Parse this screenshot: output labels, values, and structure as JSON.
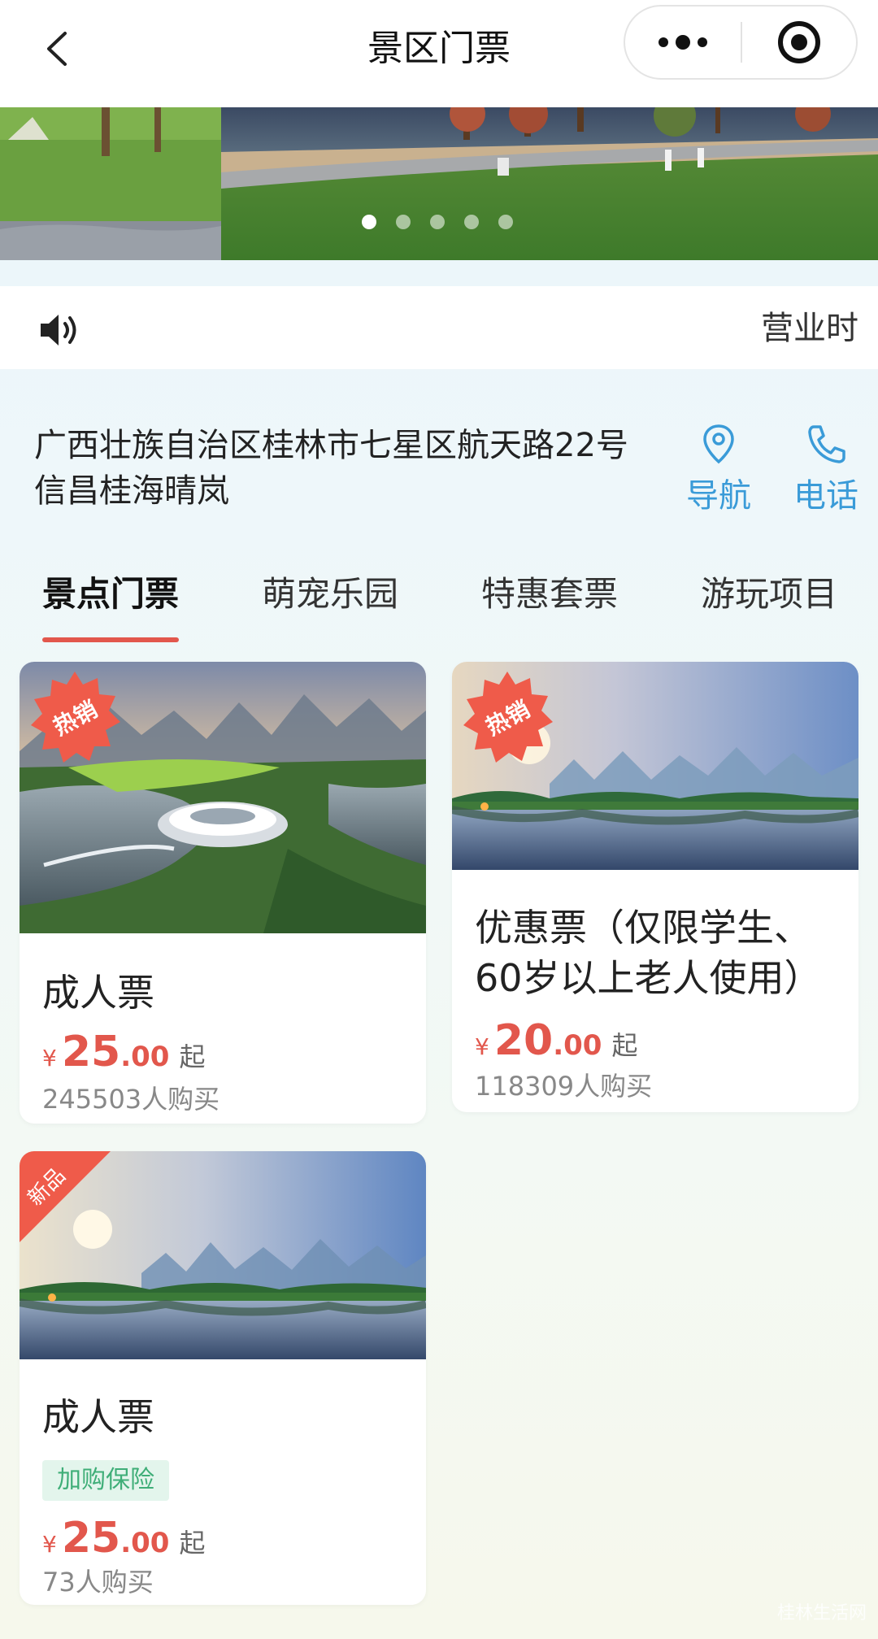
{
  "header": {
    "title": "景区门票"
  },
  "notice": {
    "hours_label": "营业时"
  },
  "address": {
    "text": "广西壮族自治区桂林市七星区航天路22号信昌桂海晴岚"
  },
  "actions": {
    "navigate": "导航",
    "phone": "电话"
  },
  "tabs": [
    {
      "label": "景点门票",
      "active": true
    },
    {
      "label": "萌宠乐园",
      "active": false
    },
    {
      "label": "特惠套票",
      "active": false
    },
    {
      "label": "游玩项目",
      "active": false
    }
  ],
  "carousel": {
    "count": 5,
    "active_index": 0
  },
  "cards": [
    {
      "badge": "热销",
      "title": "成人票",
      "yen": "¥",
      "price_int": "25",
      "price_dec": ".00",
      "from": "起",
      "sold": "245503人购买"
    },
    {
      "badge": "热销",
      "title": "优惠票（仅限学生、60岁以上老人使用）",
      "yen": "¥",
      "price_int": "20",
      "price_dec": ".00",
      "from": "起",
      "sold": "118309人购买"
    },
    {
      "badge": "新品",
      "title": "成人票",
      "tag": "加购保险",
      "yen": "¥",
      "price_int": "25",
      "price_dec": ".00",
      "from": "起",
      "sold": "73人购买"
    }
  ],
  "watermark": "桂林生活网",
  "colors": {
    "accent": "#e2574c",
    "link": "#3a9bd8",
    "insurance": "#3fae78"
  }
}
